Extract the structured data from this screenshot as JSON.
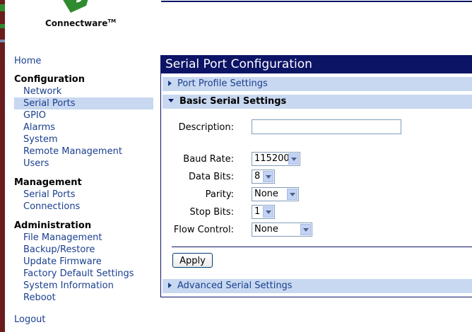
{
  "brand": {
    "name": "Connectware",
    "trademark": "TM"
  },
  "nav": {
    "home": "Home",
    "configuration": {
      "title": "Configuration",
      "items": [
        "Network",
        "Serial Ports",
        "GPIO",
        "Alarms",
        "System",
        "Remote Management",
        "Users"
      ],
      "selected": "Serial Ports"
    },
    "management": {
      "title": "Management",
      "items": [
        "Serial Ports",
        "Connections"
      ]
    },
    "administration": {
      "title": "Administration",
      "items": [
        "File Management",
        "Backup/Restore",
        "Update Firmware",
        "Factory Default Settings",
        "System Information",
        "Reboot"
      ]
    },
    "logout": "Logout"
  },
  "panel": {
    "title": "Serial Port Configuration",
    "sections": {
      "port_profile": "Port Profile Settings",
      "basic": "Basic Serial Settings",
      "advanced": "Advanced Serial Settings"
    },
    "fields": {
      "description": {
        "label": "Description:",
        "value": ""
      },
      "baud_rate": {
        "label": "Baud Rate:",
        "value": "115200"
      },
      "data_bits": {
        "label": "Data Bits:",
        "value": "8"
      },
      "parity": {
        "label": "Parity:",
        "value": "None"
      },
      "stop_bits": {
        "label": "Stop Bits:",
        "value": "1"
      },
      "flow_control": {
        "label": "Flow Control:",
        "value": "None"
      }
    },
    "apply_label": "Apply"
  },
  "colors": {
    "header_bg": "#0c1466",
    "section_bg": "#c8d8f0",
    "link": "#1a3f8f",
    "sidebar_strip": "#6b1d1d",
    "logo_green": "#2e8b2e"
  }
}
